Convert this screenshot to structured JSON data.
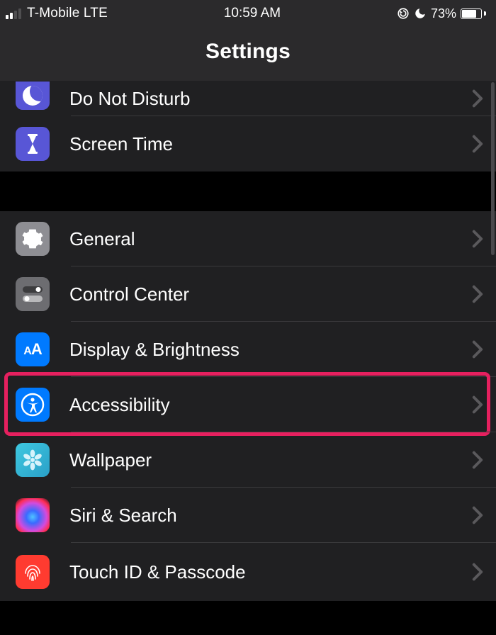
{
  "status": {
    "carrier": "T-Mobile LTE",
    "time": "10:59 AM",
    "battery_pct": "73%",
    "signal_bars_active": 2,
    "signal_bars_total": 4
  },
  "header": {
    "title": "Settings"
  },
  "sections": [
    {
      "rows": [
        {
          "id": "dnd",
          "label": "Do Not Disturb",
          "icon": "moon-icon",
          "bg": "bg-indigo"
        },
        {
          "id": "screen-time",
          "label": "Screen Time",
          "icon": "hourglass-icon",
          "bg": "bg-indigo"
        }
      ]
    },
    {
      "rows": [
        {
          "id": "general",
          "label": "General",
          "icon": "gear-icon",
          "bg": "bg-gray"
        },
        {
          "id": "control-center",
          "label": "Control Center",
          "icon": "switches-icon",
          "bg": "bg-midgray"
        },
        {
          "id": "display",
          "label": "Display & Brightness",
          "icon": "text-size-icon",
          "bg": "bg-blue"
        },
        {
          "id": "accessibility",
          "label": "Accessibility",
          "icon": "accessibility-icon",
          "bg": "bg-blue",
          "highlight": true
        },
        {
          "id": "wallpaper",
          "label": "Wallpaper",
          "icon": "flower-icon",
          "bg": "bg-flowerwrap"
        },
        {
          "id": "siri",
          "label": "Siri & Search",
          "icon": "siri-icon",
          "bg": "bg-siri"
        },
        {
          "id": "touchid",
          "label": "Touch ID & Passcode",
          "icon": "fingerprint-icon",
          "bg": "bg-red"
        }
      ]
    }
  ],
  "icons": {
    "chevron": "chevron-right-icon",
    "orientation_lock": "orientation-lock-icon",
    "dnd_moon": "moon-icon",
    "battery": "battery-icon",
    "signal": "signal-bars-icon"
  }
}
